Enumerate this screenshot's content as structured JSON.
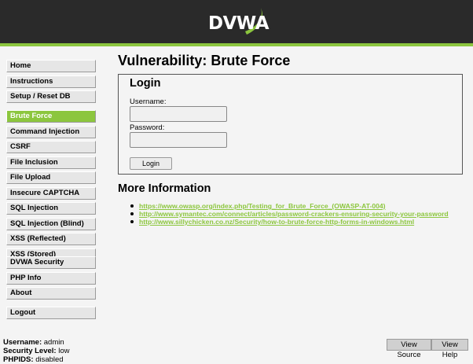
{
  "header": {
    "logo_text": "DVWA",
    "accent_color": "#8cc63e",
    "background_color": "#2a2a2a"
  },
  "menu": {
    "group1": [
      "Home",
      "Instructions",
      "Setup / Reset DB"
    ],
    "group2": [
      "Brute Force",
      "Command Injection",
      "CSRF",
      "File Inclusion",
      "File Upload",
      "Insecure CAPTCHA",
      "SQL Injection",
      "SQL Injection (Blind)",
      "XSS (Reflected)",
      "XSS (Stored)"
    ],
    "group3": [
      "DVWA Security",
      "PHP Info",
      "About"
    ],
    "group4": [
      "Logout"
    ],
    "selected": "Brute Force"
  },
  "main": {
    "title": "Vulnerability: Brute Force",
    "login": {
      "heading": "Login",
      "username_label": "Username:",
      "username_value": "",
      "password_label": "Password:",
      "password_value": "",
      "button_label": "Login"
    },
    "more_info": {
      "heading": "More Information",
      "links": [
        "https://www.owasp.org/index.php/Testing_for_Brute_Force_(OWASP-AT-004)",
        "http://www.symantec.com/connect/articles/password-crackers-ensuring-security-your-password",
        "http://www.sillychicken.co.nz/Security/how-to-brute-force-http-forms-in-windows.html"
      ]
    }
  },
  "footer": {
    "username_label": "Username:",
    "username_value": "admin",
    "security_label": "Security Level:",
    "security_value": "low",
    "phpids_label": "PHPIDS:",
    "phpids_value": "disabled",
    "view_source_label": "View Source",
    "view_help_label": "View Help"
  }
}
